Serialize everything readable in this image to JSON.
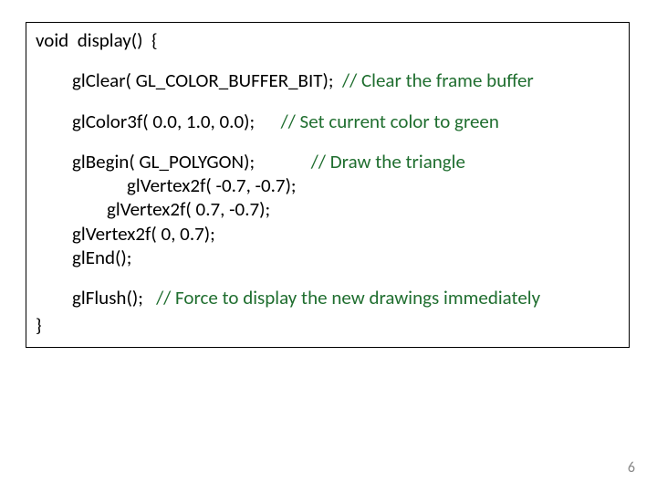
{
  "code": {
    "l1": "void  display()  {",
    "l2_code": "glClear( GL_COLOR_BUFFER_BIT);  ",
    "l2_comment": "// Clear the frame buffer",
    "l3_code": "glColor3f( 0.0, 1.0, 0.0);      ",
    "l3_comment": "// Set current color to green",
    "l4_code": "glBegin( GL_POLYGON);             ",
    "l4_comment": "// Draw the triangle",
    "l5": "glVertex2f( -0.7, -0.7);",
    "l6": "glVertex2f( 0.7, -0.7);",
    "l7": "glVertex2f( 0, 0.7);",
    "l8": "glEnd();",
    "l9_code": "glFlush();   ",
    "l9_comment": "// Force to display the new drawings immediately",
    "l10": "}"
  },
  "page_number": "6"
}
